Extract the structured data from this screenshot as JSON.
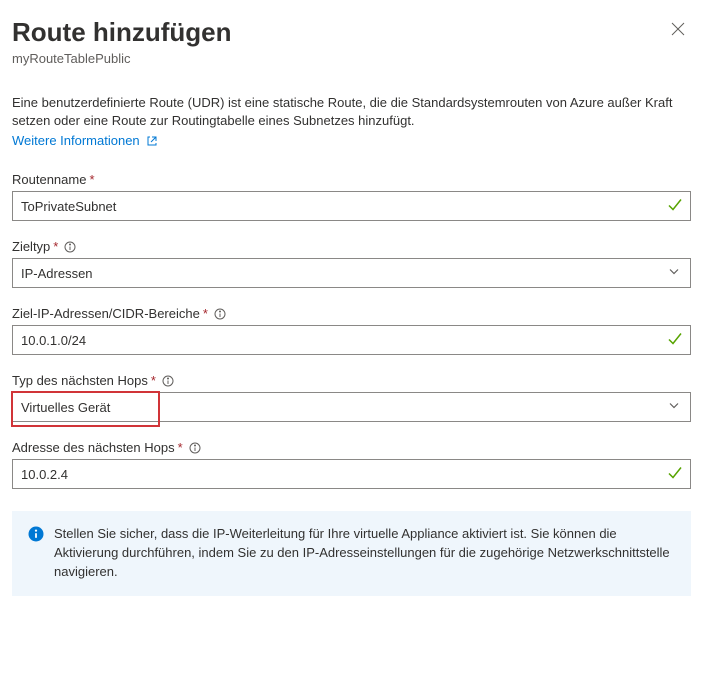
{
  "header": {
    "title": "Route hinzufügen",
    "subtitle": "myRouteTablePublic"
  },
  "description": "Eine benutzerdefinierte Route (UDR) ist eine statische Route, die die Standardsystemrouten von Azure außer Kraft setzen oder eine Route zur Routingtabelle eines Subnetzes hinzufügt.",
  "learn_more_label": "Weitere Informationen",
  "fields": {
    "route_name": {
      "label": "Routenname",
      "value": "ToPrivateSubnet"
    },
    "dest_type": {
      "label": "Zieltyp",
      "value": "IP-Adressen"
    },
    "dest_cidr": {
      "label": "Ziel-IP-Adressen/CIDR-Bereiche",
      "value": "10.0.1.0/24"
    },
    "next_hop_type": {
      "label": "Typ des nächsten Hops",
      "value": "Virtuelles Gerät"
    },
    "next_hop_addr": {
      "label": "Adresse des nächsten Hops",
      "value": "10.0.2.4"
    }
  },
  "info_banner": "Stellen Sie sicher, dass die IP-Weiterleitung für Ihre virtuelle Appliance aktiviert ist. Sie können die Aktivierung durchführen, indem Sie zu den IP-Adresseinstellungen für die zugehörige Netzwerkschnittstelle navigieren."
}
